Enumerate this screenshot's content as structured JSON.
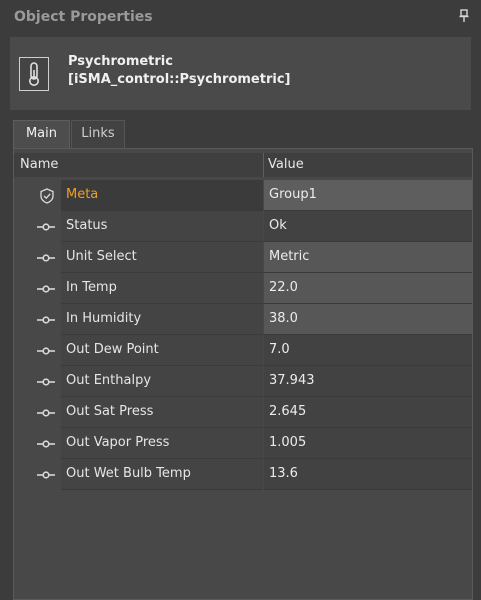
{
  "panel": {
    "title": "Object Properties",
    "icon": "pin-icon"
  },
  "object": {
    "name": "Psychrometric",
    "type": "[iSMA_control::Psychrometric]",
    "icon": "thermometer-icon"
  },
  "tabs": [
    {
      "label": "Main",
      "active": true
    },
    {
      "label": "Links",
      "active": false
    }
  ],
  "table": {
    "headers": {
      "name": "Name",
      "value": "Value"
    },
    "rows": [
      {
        "name": "Meta",
        "value": "Group1",
        "icon": "shield-icon",
        "selected": true
      },
      {
        "name": "Status",
        "value": "Ok",
        "icon": "slot-icon"
      },
      {
        "name": "Unit Select",
        "value": "Metric",
        "icon": "slot-icon",
        "editable": true
      },
      {
        "name": "In Temp",
        "value": "22.0",
        "icon": "slot-icon",
        "editable": true
      },
      {
        "name": "In Humidity",
        "value": "38.0",
        "icon": "slot-icon",
        "editable": true
      },
      {
        "name": "Out Dew Point",
        "value": "7.0",
        "icon": "slot-icon"
      },
      {
        "name": "Out Enthalpy",
        "value": "37.943",
        "icon": "slot-icon"
      },
      {
        "name": "Out Sat Press",
        "value": "2.645",
        "icon": "slot-icon"
      },
      {
        "name": "Out Vapor Press",
        "value": "1.005",
        "icon": "slot-icon"
      },
      {
        "name": "Out Wet Bulb Temp",
        "value": "13.6",
        "icon": "slot-icon"
      }
    ]
  },
  "colors": {
    "highlight": "#f0a020",
    "background": "#3c3c3c"
  }
}
